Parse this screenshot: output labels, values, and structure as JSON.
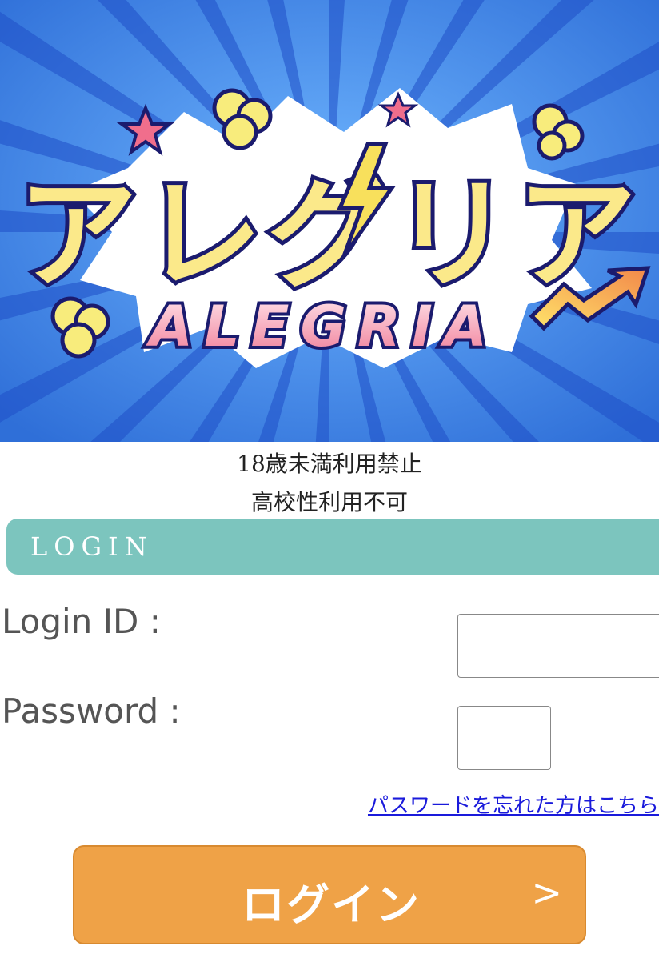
{
  "banner": {
    "logo_katakana": "アレグリア",
    "logo_latin": "ALEGRIA"
  },
  "notices": [
    "18歳未満利用禁止",
    "高校性利用不可"
  ],
  "login_section": {
    "title": "LOGIN"
  },
  "form": {
    "login_id_label": "Login ID :",
    "login_id_value": "",
    "password_label": "Password :",
    "password_value": ""
  },
  "forgot_link": "パスワードを忘れた方はこちら",
  "submit_button": {
    "label": "ログイン",
    "arrow": ">"
  },
  "colors": {
    "banner_blue": "#3f8fe8",
    "section_bar": "#7cc5be",
    "button_orange": "#efa247",
    "link_blue": "#1a1adb"
  }
}
